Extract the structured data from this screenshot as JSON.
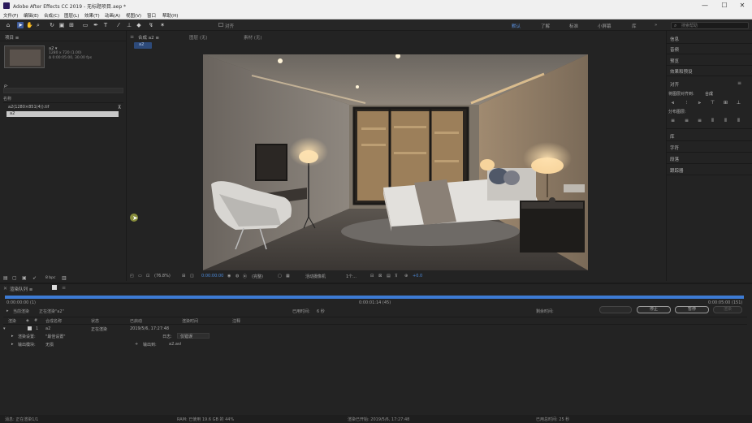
{
  "window": {
    "title": "Adobe After Effects CC 2019 - 无标题项目.aep *",
    "minimize": "—",
    "maximize": "☐",
    "close": "✕"
  },
  "menu": [
    "文件(F)",
    "编辑(E)",
    "合成(C)",
    "图层(L)",
    "效果(T)",
    "动画(A)",
    "视图(V)",
    "窗口",
    "帮助(H)"
  ],
  "toolbar": {
    "snap_label": "对齐",
    "workspaces": [
      "默认",
      "了解",
      "标准",
      "小屏幕",
      "库"
    ],
    "active_workspace": "默认",
    "search_placeholder": "搜索帮助"
  },
  "project_panel": {
    "tab": "项目 ≡",
    "item_name": "a2 ▾",
    "item_info_1": "1280 x 720 (1.00)",
    "item_info_2": "Δ 0:00:05:00, 30.00 fps",
    "search_icon": "ρ-",
    "column_header": "名称",
    "rows": [
      "a2(1280×851(4)).tif",
      "a2"
    ],
    "bpc": "8 bpc"
  },
  "comp_panel": {
    "tabs": [
      "合成 a2 ≡",
      "图层 (无)",
      "素材 (无)"
    ],
    "breadcrumb": "a2",
    "zoom": "(76.8%)",
    "timecode": "0:00:00:00",
    "resolution": "(完整)",
    "camera": "活动摄像机",
    "views": "1个...",
    "exposure": "+0.0"
  },
  "right_panel": {
    "items": [
      "信息",
      "音频",
      "预览",
      "效果和预设"
    ],
    "align_title": "对齐",
    "align_to_label": "将图层对齐到:",
    "align_to_value": "合成",
    "distribute_label": "分布图层:",
    "items2": [
      "库",
      "字符",
      "段落",
      "跟踪器"
    ]
  },
  "render_queue": {
    "tabs": [
      "渲染队列 ≡"
    ],
    "time_start": "0:00:00:00 (1)",
    "time_mid": "0:00:01:14 (45)",
    "time_end": "0:00:05:00 (151)",
    "current_render": "当前渲染",
    "rendering_label": "正在渲染\"a2\"",
    "elapsed_label": "已用时间:",
    "elapsed_value": "6 秒",
    "remaining_label": "剩余时间:",
    "stop_button": "停止",
    "pause_button": "暂停",
    "render_button": "渲染",
    "columns": [
      "渲染",
      "#",
      "合成名称",
      "状态",
      "已启动",
      "渲染时间",
      "注释"
    ],
    "row_num": "1",
    "row_comp": "a2",
    "row_status": "正在渲染",
    "row_started": "2019/5/6, 17:27:48",
    "render_settings_label": "渲染设置:",
    "render_settings_value": "\"最佳设置\"",
    "log_label": "日志:",
    "log_value": "仅错误",
    "output_module_label": "输出模块:",
    "output_module_value": "无损",
    "output_to_label": "输出到:",
    "output_to_value": "a2.avi"
  },
  "status_bar": {
    "message": "消息: 正在渲染1/1",
    "ram": "RAM: 已使用 19.6 GB 的 44%",
    "render_started": "渲染已开始: 2019/5/6, 17:27:48",
    "total_time": "已用总时间: 25 秒"
  },
  "colors": {
    "accent": "#3d7bd4",
    "panel_bg": "#232323"
  }
}
